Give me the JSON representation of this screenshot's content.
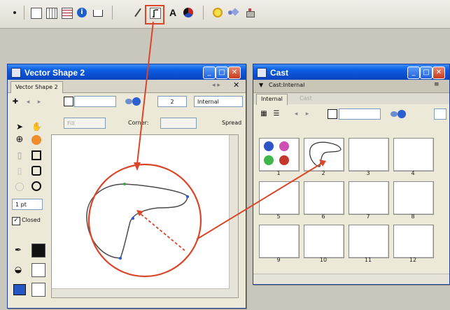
{
  "toolbar": {
    "icons": [
      "bullet-icon",
      "new-card-icon",
      "card-grid-icon",
      "card-list-icon",
      "info-icon",
      "book-icon",
      "pen-icon",
      "vector-shape-icon",
      "text-tool-icon",
      "color-icon",
      "star-icon",
      "shapes-icon",
      "stamp-icon"
    ],
    "highlighted": "vector-shape-icon",
    "text_tool_label": "A"
  },
  "vector_window": {
    "title": "Vector Shape 2",
    "tab_label": "Vector Shape 2",
    "frame_value": "2",
    "cast_select": "Internal",
    "fill_select": "Fill",
    "corner_label": "Corner:",
    "spread_label": "Spread",
    "line_width": "1 pt",
    "closed_label": "Closed",
    "closed_checked": true,
    "tools": [
      "arrow-tool",
      "hand-tool",
      "registration-tool",
      "eyedropper-tool",
      "pen-tool",
      "rectangle-tool",
      "filled-rect-tool",
      "rounded-rect-tool",
      "filled-ellipse-tool",
      "ellipse-tool"
    ]
  },
  "cast_window": {
    "title": "Cast",
    "header": "Cast:Internal",
    "tab_active": "Internal",
    "tab_other": "Cast",
    "members": [
      "1",
      "2",
      "3",
      "4",
      "5",
      "6",
      "7",
      "8",
      "9",
      "10",
      "11",
      "12"
    ],
    "member1_colors": [
      "#2d55c8",
      "#d04fb4",
      "#3fb64a",
      "#c4372c"
    ]
  },
  "annotation": {
    "color": "#d9472a"
  }
}
